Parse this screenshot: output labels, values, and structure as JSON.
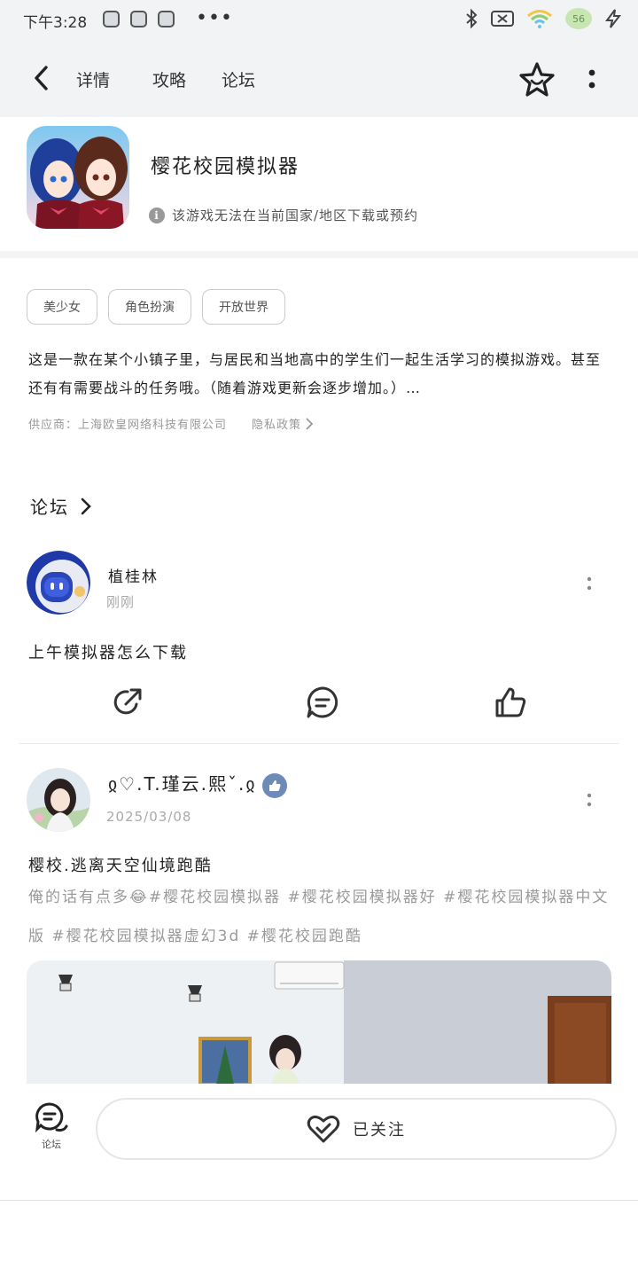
{
  "status": {
    "time": "下午3:28",
    "battery": "56",
    "icons": [
      "app-notify-icon",
      "app-notify-icon",
      "app-notify-icon",
      "more-dots-icon",
      "bluetooth-icon",
      "no-sim-icon",
      "wifi-icon",
      "battery-icon",
      "charging-icon"
    ]
  },
  "nav": {
    "tabs": [
      {
        "label": "详情"
      },
      {
        "label": "攻略"
      },
      {
        "label": "论坛"
      }
    ]
  },
  "app": {
    "name": "樱花校园模拟器",
    "notice": "该游戏无法在当前国家/地区下载或预约"
  },
  "tags": [
    "美少女",
    "角色扮演",
    "开放世界"
  ],
  "description": "这是一款在某个小镇子里，与居民和当地高中的学生们一起生活学习的模拟游戏。甚至还有有需要战斗的任务哦。（随着游戏更新会逐步增加。）…",
  "vendor": {
    "provider": "供应商：上海欧皇网络科技有限公司",
    "privacy": "隐私政策"
  },
  "forum": {
    "title": "论坛"
  },
  "posts": [
    {
      "user": "植桂林",
      "time": "刚刚",
      "title": "上午模拟器怎么下载"
    },
    {
      "user": "ჲ♡.T.瑾云.熙ˇ.ჲ",
      "time": "2025/03/08",
      "title": "樱校.逃离天空仙境跑酷",
      "tags_text": "俺的话有点多😂#樱花校园模拟器 #樱花校园模拟器好 #樱花校园模拟器中文版 #樱花校园模拟器虚幻3d #樱花校园跑酷"
    }
  ],
  "bottom": {
    "forum_label": "论坛",
    "follow_label": "已关注"
  },
  "colors": {
    "accent": "#25d2c0",
    "muted_text": "#9a9a9a",
    "verified": "#6e8bb8"
  }
}
